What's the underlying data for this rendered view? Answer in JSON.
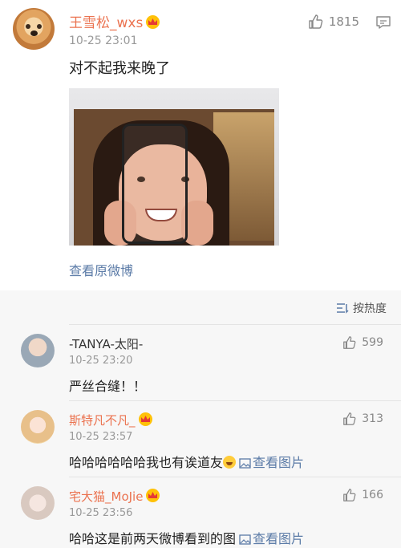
{
  "post": {
    "username": "王雪松_wxs",
    "time": "10-25 23:01",
    "likes": "1815",
    "text": "对不起我来晚了",
    "view_original": "查看原微博"
  },
  "sort": {
    "label": "按热度"
  },
  "comments": [
    {
      "name": "-TANYA-太阳-",
      "name_color": "#333333",
      "time": "10-25 23:20",
      "text": "严丝合缝！！",
      "likes": "599"
    },
    {
      "name": "斯特凡不凡_",
      "name_color": "#eb7350",
      "time": "10-25 23:57",
      "text": "哈哈哈哈哈哈我也有诶道友",
      "link": "查看图片",
      "likes": "313"
    },
    {
      "name": "宅大猫_MoJie",
      "name_color": "#eb7350",
      "time": "10-25 23:56",
      "text": "哈哈这是前两天微博看到的图",
      "link": "查看图片",
      "likes": "166"
    }
  ],
  "icons": [
    "thumb-up-icon",
    "comment-icon",
    "crown-icon",
    "sort-icon",
    "picture-icon",
    "laugh-emoji-icon"
  ],
  "colors": {
    "accent_name": "#eb7350",
    "link": "#5b7ba7",
    "comment_bg": "#f7f7f7"
  }
}
